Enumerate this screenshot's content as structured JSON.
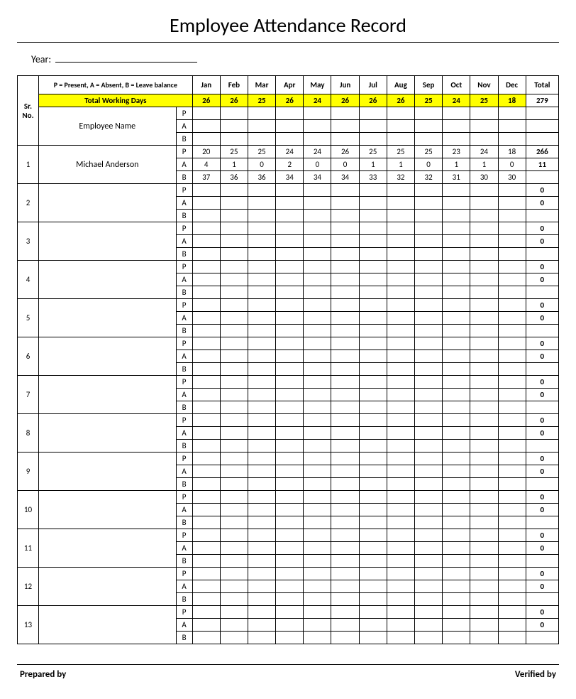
{
  "title": "Employee Attendance Record",
  "year_label": "Year:",
  "legend": "P = Present, A = Absent, B = Leave balance",
  "header": {
    "sr": "Sr. No.",
    "name_header": "Employee Name",
    "months": [
      "Jan",
      "Feb",
      "Mar",
      "Apr",
      "May",
      "Jun",
      "Jul",
      "Aug",
      "Sep",
      "Oct",
      "Nov",
      "Dec"
    ],
    "total": "Total"
  },
  "twd": {
    "label": "Total Working Days",
    "values": [
      "26",
      "26",
      "25",
      "26",
      "24",
      "26",
      "26",
      "26",
      "25",
      "24",
      "25",
      "18"
    ],
    "total": "279"
  },
  "pab": [
    "P",
    "A",
    "B"
  ],
  "employees": [
    {
      "sr": "1",
      "name": "Michael Anderson",
      "P": [
        "20",
        "25",
        "25",
        "24",
        "24",
        "26",
        "25",
        "25",
        "25",
        "23",
        "24",
        "18"
      ],
      "Ptot": "266",
      "A": [
        "4",
        "1",
        "0",
        "2",
        "0",
        "0",
        "1",
        "1",
        "0",
        "1",
        "1",
        "0"
      ],
      "Atot": "11",
      "B": [
        "37",
        "36",
        "36",
        "34",
        "34",
        "34",
        "33",
        "32",
        "32",
        "31",
        "30",
        "30"
      ],
      "Btot": ""
    },
    {
      "sr": "2",
      "name": "",
      "P": [
        "",
        "",
        "",
        "",
        "",
        "",
        "",
        "",
        "",
        "",
        "",
        ""
      ],
      "Ptot": "0",
      "A": [
        "",
        "",
        "",
        "",
        "",
        "",
        "",
        "",
        "",
        "",
        "",
        ""
      ],
      "Atot": "0",
      "B": [
        "",
        "",
        "",
        "",
        "",
        "",
        "",
        "",
        "",
        "",
        "",
        ""
      ],
      "Btot": ""
    },
    {
      "sr": "3",
      "name": "",
      "P": [
        "",
        "",
        "",
        "",
        "",
        "",
        "",
        "",
        "",
        "",
        "",
        ""
      ],
      "Ptot": "0",
      "A": [
        "",
        "",
        "",
        "",
        "",
        "",
        "",
        "",
        "",
        "",
        "",
        ""
      ],
      "Atot": "0",
      "B": [
        "",
        "",
        "",
        "",
        "",
        "",
        "",
        "",
        "",
        "",
        "",
        ""
      ],
      "Btot": ""
    },
    {
      "sr": "4",
      "name": "",
      "P": [
        "",
        "",
        "",
        "",
        "",
        "",
        "",
        "",
        "",
        "",
        "",
        ""
      ],
      "Ptot": "0",
      "A": [
        "",
        "",
        "",
        "",
        "",
        "",
        "",
        "",
        "",
        "",
        "",
        ""
      ],
      "Atot": "0",
      "B": [
        "",
        "",
        "",
        "",
        "",
        "",
        "",
        "",
        "",
        "",
        "",
        ""
      ],
      "Btot": ""
    },
    {
      "sr": "5",
      "name": "",
      "P": [
        "",
        "",
        "",
        "",
        "",
        "",
        "",
        "",
        "",
        "",
        "",
        ""
      ],
      "Ptot": "0",
      "A": [
        "",
        "",
        "",
        "",
        "",
        "",
        "",
        "",
        "",
        "",
        "",
        ""
      ],
      "Atot": "0",
      "B": [
        "",
        "",
        "",
        "",
        "",
        "",
        "",
        "",
        "",
        "",
        "",
        ""
      ],
      "Btot": ""
    },
    {
      "sr": "6",
      "name": "",
      "P": [
        "",
        "",
        "",
        "",
        "",
        "",
        "",
        "",
        "",
        "",
        "",
        ""
      ],
      "Ptot": "0",
      "A": [
        "",
        "",
        "",
        "",
        "",
        "",
        "",
        "",
        "",
        "",
        "",
        ""
      ],
      "Atot": "0",
      "B": [
        "",
        "",
        "",
        "",
        "",
        "",
        "",
        "",
        "",
        "",
        "",
        ""
      ],
      "Btot": ""
    },
    {
      "sr": "7",
      "name": "",
      "P": [
        "",
        "",
        "",
        "",
        "",
        "",
        "",
        "",
        "",
        "",
        "",
        ""
      ],
      "Ptot": "0",
      "A": [
        "",
        "",
        "",
        "",
        "",
        "",
        "",
        "",
        "",
        "",
        "",
        ""
      ],
      "Atot": "0",
      "B": [
        "",
        "",
        "",
        "",
        "",
        "",
        "",
        "",
        "",
        "",
        "",
        ""
      ],
      "Btot": ""
    },
    {
      "sr": "8",
      "name": "",
      "P": [
        "",
        "",
        "",
        "",
        "",
        "",
        "",
        "",
        "",
        "",
        "",
        ""
      ],
      "Ptot": "0",
      "A": [
        "",
        "",
        "",
        "",
        "",
        "",
        "",
        "",
        "",
        "",
        "",
        ""
      ],
      "Atot": "0",
      "B": [
        "",
        "",
        "",
        "",
        "",
        "",
        "",
        "",
        "",
        "",
        "",
        ""
      ],
      "Btot": ""
    },
    {
      "sr": "9",
      "name": "",
      "P": [
        "",
        "",
        "",
        "",
        "",
        "",
        "",
        "",
        "",
        "",
        "",
        ""
      ],
      "Ptot": "0",
      "A": [
        "",
        "",
        "",
        "",
        "",
        "",
        "",
        "",
        "",
        "",
        "",
        ""
      ],
      "Atot": "0",
      "B": [
        "",
        "",
        "",
        "",
        "",
        "",
        "",
        "",
        "",
        "",
        "",
        ""
      ],
      "Btot": ""
    },
    {
      "sr": "10",
      "name": "",
      "P": [
        "",
        "",
        "",
        "",
        "",
        "",
        "",
        "",
        "",
        "",
        "",
        ""
      ],
      "Ptot": "0",
      "A": [
        "",
        "",
        "",
        "",
        "",
        "",
        "",
        "",
        "",
        "",
        "",
        ""
      ],
      "Atot": "0",
      "B": [
        "",
        "",
        "",
        "",
        "",
        "",
        "",
        "",
        "",
        "",
        "",
        ""
      ],
      "Btot": ""
    },
    {
      "sr": "11",
      "name": "",
      "P": [
        "",
        "",
        "",
        "",
        "",
        "",
        "",
        "",
        "",
        "",
        "",
        ""
      ],
      "Ptot": "0",
      "A": [
        "",
        "",
        "",
        "",
        "",
        "",
        "",
        "",
        "",
        "",
        "",
        ""
      ],
      "Atot": "0",
      "B": [
        "",
        "",
        "",
        "",
        "",
        "",
        "",
        "",
        "",
        "",
        "",
        ""
      ],
      "Btot": ""
    },
    {
      "sr": "12",
      "name": "",
      "P": [
        "",
        "",
        "",
        "",
        "",
        "",
        "",
        "",
        "",
        "",
        "",
        ""
      ],
      "Ptot": "0",
      "A": [
        "",
        "",
        "",
        "",
        "",
        "",
        "",
        "",
        "",
        "",
        "",
        ""
      ],
      "Atot": "0",
      "B": [
        "",
        "",
        "",
        "",
        "",
        "",
        "",
        "",
        "",
        "",
        "",
        ""
      ],
      "Btot": ""
    },
    {
      "sr": "13",
      "name": "",
      "P": [
        "",
        "",
        "",
        "",
        "",
        "",
        "",
        "",
        "",
        "",
        "",
        ""
      ],
      "Ptot": "0",
      "A": [
        "",
        "",
        "",
        "",
        "",
        "",
        "",
        "",
        "",
        "",
        "",
        ""
      ],
      "Atot": "0",
      "B": [
        "",
        "",
        "",
        "",
        "",
        "",
        "",
        "",
        "",
        "",
        "",
        ""
      ],
      "Btot": ""
    }
  ],
  "footer": {
    "prepared": "Prepared by",
    "verified": "Verified by"
  }
}
